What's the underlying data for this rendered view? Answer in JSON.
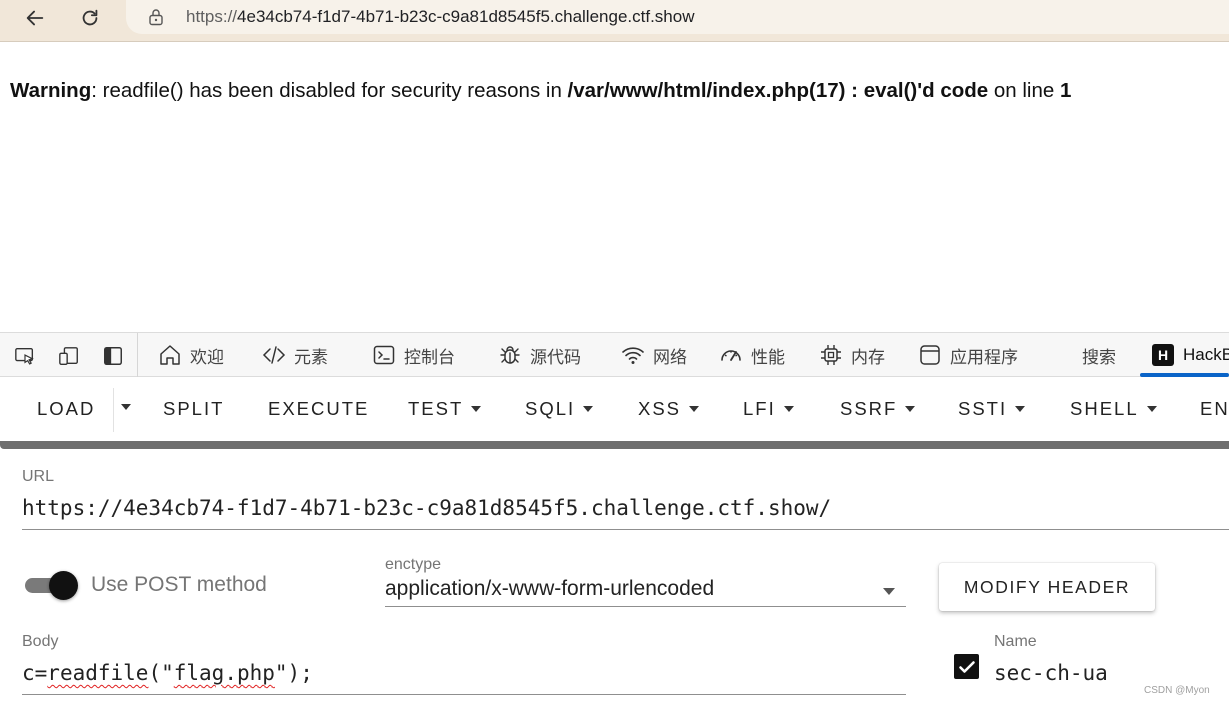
{
  "browser": {
    "url_scheme": "https://",
    "url_host": "4e34cb74-f1d7-4b71-b23c-c9a81d8545f5.challenge.ctf.show",
    "icons": [
      "back-arrow-icon",
      "reload-icon",
      "lock-icon"
    ]
  },
  "page": {
    "warning_label": "Warning",
    "warning_message": ": readfile() has been disabled for security reasons in ",
    "warning_path": "/var/www/html/index.php(17) : eval()'d code",
    "warning_on_line": " on line ",
    "warning_line": "1"
  },
  "devtools": {
    "tabs": [
      {
        "label": "欢迎",
        "icon": "home-icon"
      },
      {
        "label": "元素",
        "icon": "code-icon"
      },
      {
        "label": "控制台",
        "icon": "console-icon"
      },
      {
        "label": "源代码",
        "icon": "bug-icon"
      },
      {
        "label": "网络",
        "icon": "wifi-icon"
      },
      {
        "label": "性能",
        "icon": "gauge-icon"
      },
      {
        "label": "内存",
        "icon": "chip-icon"
      },
      {
        "label": "应用程序",
        "icon": "app-icon"
      },
      {
        "label": "搜索",
        "icon": ""
      },
      {
        "label": "HackB",
        "icon": "hackbar-icon",
        "active": true
      }
    ],
    "hackbar_logo_letter": "H"
  },
  "hackbar": {
    "toolbar": [
      "LOAD",
      "SPLIT",
      "EXECUTE",
      "TEST",
      "SQLI",
      "XSS",
      "LFI",
      "SSRF",
      "SSTI",
      "SHELL",
      "EN"
    ],
    "url_label": "URL",
    "url_value": "https://4e34cb74-f1d7-4b71-b23c-c9a81d8545f5.challenge.ctf.show/",
    "post_toggle_label": "Use POST method",
    "post_enabled": true,
    "enctype_label": "enctype",
    "enctype_value": "application/x-www-form-urlencoded",
    "modify_header_label": "MODIFY HEADER",
    "body_label": "Body",
    "body_prefix": "c=",
    "body_func": "readfile",
    "body_open": "(\"",
    "body_file": "flag.php",
    "body_close": "\");",
    "header_enabled": true,
    "name_label": "Name",
    "name_value": "sec-ch-ua"
  },
  "watermark": "CSDN @Myon⁠"
}
